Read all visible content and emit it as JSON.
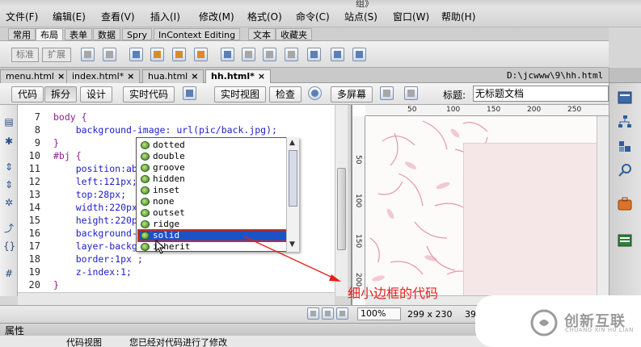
{
  "app": {
    "partial_top_text": "组》"
  },
  "menu": {
    "items": [
      "文件(F)",
      "编辑(E)",
      "查看(V)",
      "插入(I)",
      "修改(M)",
      "格式(O)",
      "命令(C)",
      "站点(S)",
      "窗口(W)",
      "帮助(H)"
    ]
  },
  "insert_panel": {
    "tabs": [
      "常用",
      "布局",
      "表单",
      "数据",
      "Spry",
      "InContext Editing",
      "文本",
      "收藏夹"
    ],
    "active_tab": "布局",
    "segment_buttons": [
      "标准",
      "扩展"
    ]
  },
  "document_tabs": {
    "tabs": [
      "menu.html",
      "index.html*",
      "hua.html",
      "hh.html*"
    ],
    "active": "hh.html*",
    "path": "D:\\jcwww\\9\\hh.html"
  },
  "doc_toolbar": {
    "code": "代码",
    "split": "拆分",
    "design": "设计",
    "live_code": "实时代码",
    "live_view": "实时视图",
    "inspect": "检查",
    "multiscreen": "多屏幕",
    "title_label": "标题:",
    "title_value": "无标题文档"
  },
  "code": {
    "line_numbers": [
      "7",
      "8",
      "9",
      "10",
      "11",
      "12",
      "13",
      "14",
      "15",
      "16",
      "17",
      "18",
      "19",
      "20"
    ],
    "lines": [
      "body {",
      "    background-image: url(pic/back.jpg);",
      "}",
      "#bj {",
      "    position:ab",
      "    left:121px;",
      "    top:28px;",
      "    width:220px",
      "    height:220p",
      "    background-",
      "    layer-backg",
      "    border:1px ;",
      "    z-index:1;",
      "}"
    ]
  },
  "autocomplete": {
    "items": [
      "dotted",
      "double",
      "groove",
      "hidden",
      "inset",
      "none",
      "outset",
      "ridge",
      "solid",
      "inherit"
    ],
    "selected": "solid"
  },
  "design_view": {
    "ruler_marks": [
      "50",
      "100",
      "150",
      "200",
      "250"
    ],
    "ruler_left_marks": [
      "50",
      "100",
      "150",
      "200"
    ]
  },
  "status": {
    "zoom": "100%",
    "dimensions": "299 x 230",
    "partial_size": "39"
  },
  "properties": {
    "title": "属性",
    "row_left": "代码视图",
    "row_middle": "您已经对代码进行了修改"
  },
  "annotation": {
    "text": "细小边框的代码",
    "color": "#e4211b"
  },
  "watermark": {
    "title": "创新互联",
    "subtitle": "CHUANG XIN HU LIAN"
  },
  "colors": {
    "selection": "#1a53c8",
    "keyword": "#1d1dc8",
    "annotation_red": "#e4211b"
  }
}
